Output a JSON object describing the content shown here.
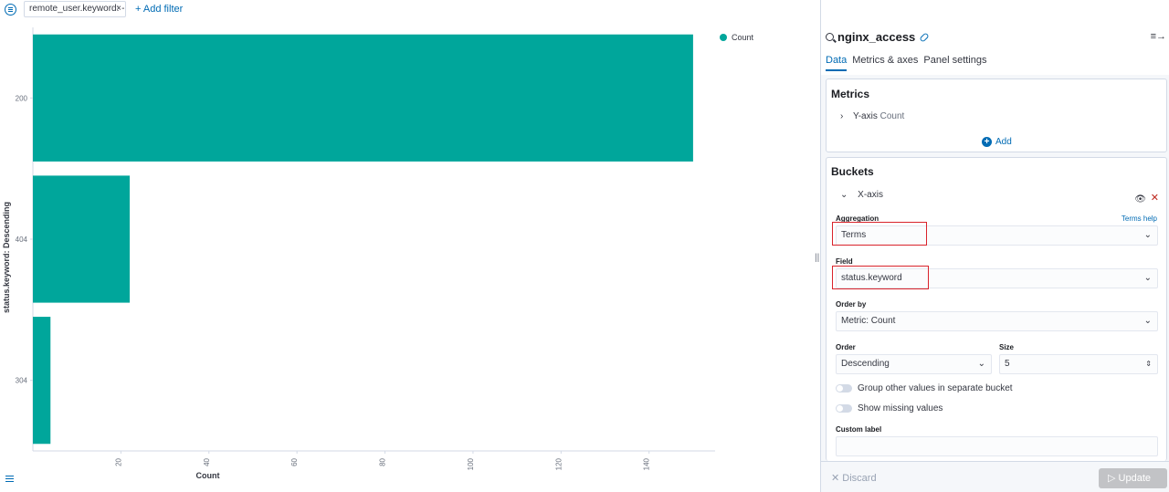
{
  "filter_bar": {
    "filter_pill_label": "remote_user.keyword: -",
    "filter_pill_close": "×",
    "add_filter_label": "+ Add filter"
  },
  "chart_data": {
    "type": "bar",
    "orientation": "horizontal",
    "categories": [
      "200",
      "404",
      "304"
    ],
    "series": [
      {
        "name": "Count",
        "values": [
          150,
          22,
          4
        ],
        "color": "#00a69b"
      }
    ],
    "xlabel": "Count",
    "ylabel": "status.keyword: Descending",
    "xticks": [
      "20",
      "40",
      "60",
      "80",
      "100",
      "120",
      "140"
    ],
    "xlim": [
      0,
      155
    ],
    "legend_position": "top-right"
  },
  "panel": {
    "index_name": "nginx_access",
    "collapse_label": "≡→",
    "tabs": [
      {
        "label": "Data",
        "active": true
      },
      {
        "label": "Metrics & axes",
        "active": false
      },
      {
        "label": "Panel settings",
        "active": false
      }
    ],
    "metrics": {
      "title": "Metrics",
      "y_axis_label": "Y-axis",
      "y_axis_agg": "Count",
      "add_label": "Add"
    },
    "buckets": {
      "title": "Buckets",
      "x_axis_label": "X-axis",
      "aggregation_label": "Aggregation",
      "terms_help": "Terms help",
      "aggregation_value": "Terms",
      "field_label": "Field",
      "field_value": "status.keyword",
      "order_by_label": "Order by",
      "order_by_value": "Metric: Count",
      "order_label": "Order",
      "order_value": "Descending",
      "size_label": "Size",
      "size_value": "5",
      "group_other_label": "Group other values in separate bucket",
      "show_missing_label": "Show missing values",
      "custom_label_label": "Custom label"
    },
    "footer": {
      "discard_label": "Discard",
      "update_label": "Update"
    }
  },
  "colors": {
    "accent": "#006bb4",
    "bar": "#00a69b",
    "highlight": "#d9232b"
  }
}
